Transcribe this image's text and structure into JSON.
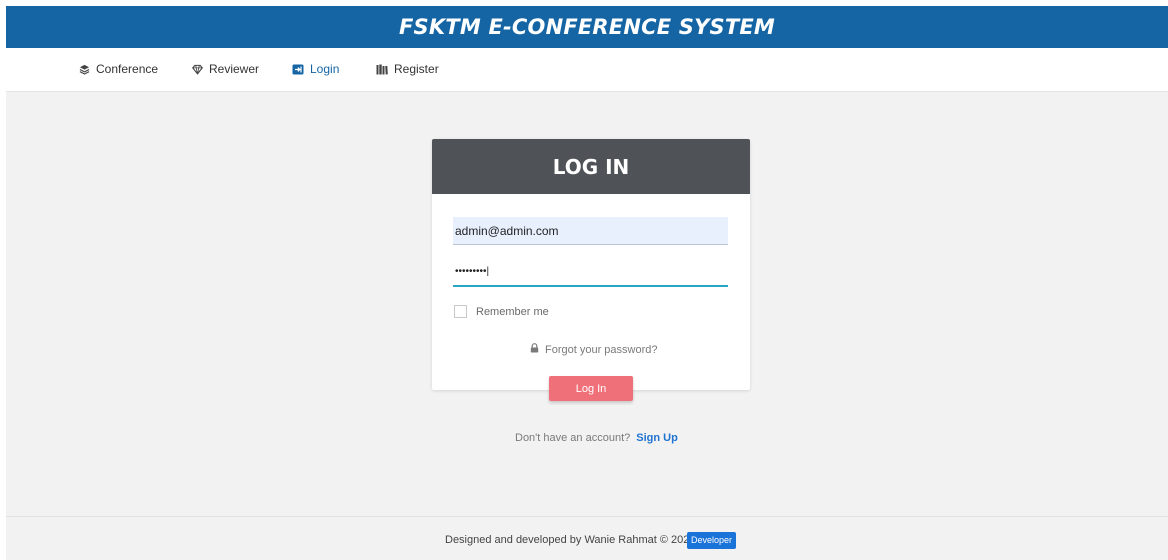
{
  "app": {
    "title": "FSKTM E-CONFERENCE SYSTEM"
  },
  "nav": {
    "items": [
      {
        "label": "Conference",
        "icon": "layers-icon",
        "active": false
      },
      {
        "label": "Reviewer",
        "icon": "diamond-icon",
        "active": false
      },
      {
        "label": "Login",
        "icon": "login-icon",
        "active": true
      },
      {
        "label": "Register",
        "icon": "books-icon",
        "active": false
      }
    ]
  },
  "login_card": {
    "heading": "LOG IN",
    "email_value": "admin@admin.com",
    "password_value": "•••••••••|",
    "remember_label": "Remember me",
    "remember_checked": false,
    "forgot_label": "Forgot your password?",
    "submit_label": "Log In"
  },
  "signup": {
    "prompt": "Don't have an account?",
    "link_label": "Sign Up"
  },
  "footer": {
    "text": "Designed and developed by Wanie Rahmat © 2024.",
    "badge_label": "Developer"
  },
  "colors": {
    "brand_blue": "#1565a5",
    "header_gray": "#4f5357",
    "button_pink": "#f0707a",
    "link_blue": "#1f74d1",
    "focus_teal": "#26a6c4"
  }
}
